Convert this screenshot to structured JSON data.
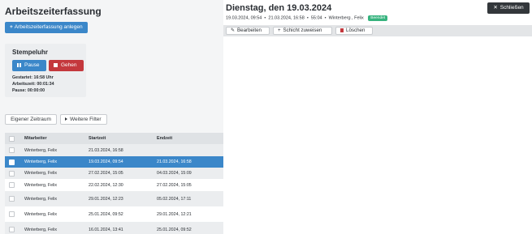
{
  "left": {
    "title": "Arbeitszeiterfassung",
    "create_button": "Arbeitszeiterfassung anlegen",
    "clock": {
      "title": "Stempeluhr",
      "pause_label": "Pause",
      "gehen_label": "Gehen",
      "started_label": "Gestartet:",
      "started_value": "16:58 Uhr",
      "worktime_label": "Arbeitszeit:",
      "worktime_value": "00:01:34",
      "pause_time_label": "Pause:",
      "pause_time_value": "00:00:00"
    },
    "filters": {
      "own_period": "Eigener Zeitraum",
      "more_filters": "Weitere Filter"
    },
    "table": {
      "headers": [
        "Mitarbeiter",
        "Startzeit",
        "Endzeit"
      ],
      "rows": [
        {
          "employee": "Winterberg, Felix",
          "start": "21.03.2024, 16:58",
          "end": "",
          "selected": false
        },
        {
          "employee": "Winterberg, Felix",
          "start": "19.03.2024, 09:54",
          "end": "21.03.2024, 16:58",
          "selected": true
        },
        {
          "employee": "Winterberg, Felix",
          "start": "27.02.2024, 15:05",
          "end": "04.03.2024, 15:09",
          "selected": false
        },
        {
          "employee": "Winterberg, Felix",
          "start": "22.02.2024, 12:30",
          "end": "27.02.2024, 15:05",
          "selected": false
        },
        {
          "employee": "Winterberg, Felix",
          "start": "29.01.2024, 12:23",
          "end": "05.02.2024, 17:11",
          "selected": false
        },
        {
          "employee": "Winterberg, Felix",
          "start": "25.01.2024, 09:52",
          "end": "29.01.2024, 12:21",
          "selected": false
        },
        {
          "employee": "Winterberg, Felix",
          "start": "16.01.2024, 13:41",
          "end": "25.01.2024, 09:52",
          "selected": false
        }
      ]
    }
  },
  "detail": {
    "title": "Dienstag, den 19.03.2024",
    "start": "19.03.2024, 09:54",
    "end": "21.03.2024, 16:58",
    "duration": "55:04",
    "employee": "Winterberg , Felix",
    "status_badge": "Beendet",
    "close_label": "Schließen",
    "actions": {
      "edit": "Bearbeiten",
      "assign_shift": "Schicht zuweisen",
      "delete": "Löschen"
    }
  },
  "colors": {
    "primary": "#3b87c9",
    "danger": "#c4383d",
    "success": "#36b37e",
    "dark": "#33373b"
  }
}
